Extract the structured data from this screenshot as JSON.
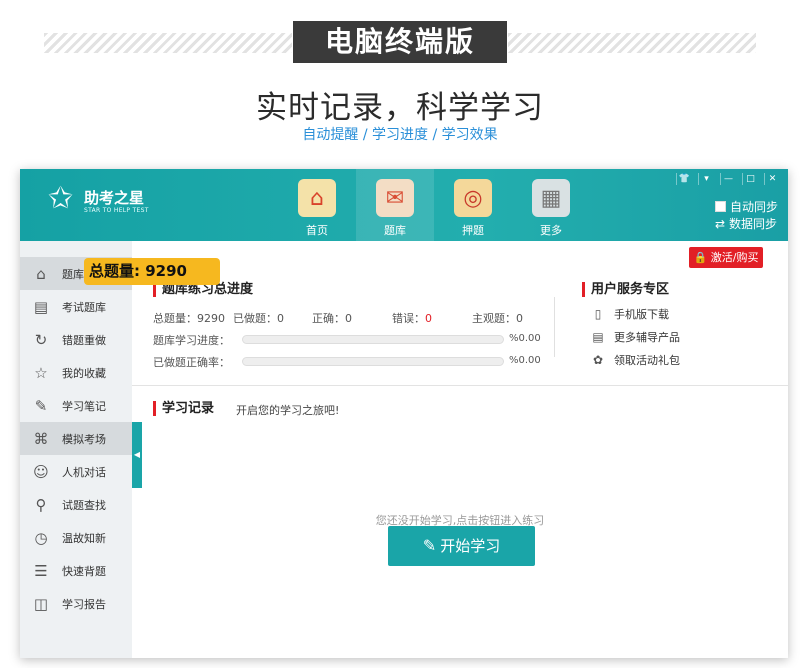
{
  "banner": {
    "title": "电脑终端版",
    "headline": "实时记录，科学学习",
    "subline": "自动提醒 / 学习进度 / 学习效果"
  },
  "app": {
    "logo_name": "助考之星",
    "logo_en": "STAR TO HELP TEST",
    "nav": [
      {
        "label": "首页",
        "icon": "home-icon"
      },
      {
        "label": "题库",
        "icon": "mail-icon"
      },
      {
        "label": "押题",
        "icon": "target-icon"
      },
      {
        "label": "更多",
        "icon": "grid-icon"
      }
    ],
    "window_controls": [
      "👕",
      "▾",
      "—",
      "□",
      "✕"
    ],
    "sync": {
      "auto": "自动同步",
      "data": "数据同步"
    }
  },
  "sidebar": {
    "items": [
      {
        "label": "题库",
        "icon": "home-icon"
      },
      {
        "label": "考试题库",
        "icon": "document-icon"
      },
      {
        "label": "错题重做",
        "icon": "refresh-icon"
      },
      {
        "label": "我的收藏",
        "icon": "star-icon"
      },
      {
        "label": "学习笔记",
        "icon": "edit-icon"
      },
      {
        "label": "模拟考场",
        "icon": "graduation-cap-icon"
      },
      {
        "label": "人机对话",
        "icon": "chat-icon"
      },
      {
        "label": "试题查找",
        "icon": "search-icon"
      },
      {
        "label": "温故知新",
        "icon": "clock-icon"
      },
      {
        "label": "快速背题",
        "icon": "list-icon"
      },
      {
        "label": "学习报告",
        "icon": "book-icon"
      }
    ]
  },
  "callout": "总题量:  9290",
  "activate_label": "激活/购买",
  "progress_section": {
    "title": "题库练习总进度",
    "stats": {
      "total": "总题量：9290",
      "done": "已做题：0",
      "correct": "正确：0",
      "wrong_label": "错误：",
      "wrong_value": "0",
      "subjective": "主观题：0"
    },
    "study_label": "题库学习进度：",
    "study_pct_text": "%0.00",
    "study_pct": 0,
    "accuracy_label": "已做题正确率：",
    "accuracy_pct_text": "%0.00",
    "accuracy_pct": 0
  },
  "service": {
    "title": "用户服务专区",
    "items": [
      {
        "label": "手机版下载",
        "icon": "phone-icon"
      },
      {
        "label": "更多辅导产品",
        "icon": "document-icon"
      },
      {
        "label": "领取活动礼包",
        "icon": "gift-icon"
      }
    ]
  },
  "record": {
    "title": "学习记录",
    "subtitle": "开启您的学习之旅吧!",
    "empty_hint": "您还没开始学习,点击按钮进入练习",
    "start_label": "开始学习"
  },
  "colors": {
    "accent": "#1aa5a8",
    "danger": "#e21f26",
    "callout": "#f6b81f"
  }
}
